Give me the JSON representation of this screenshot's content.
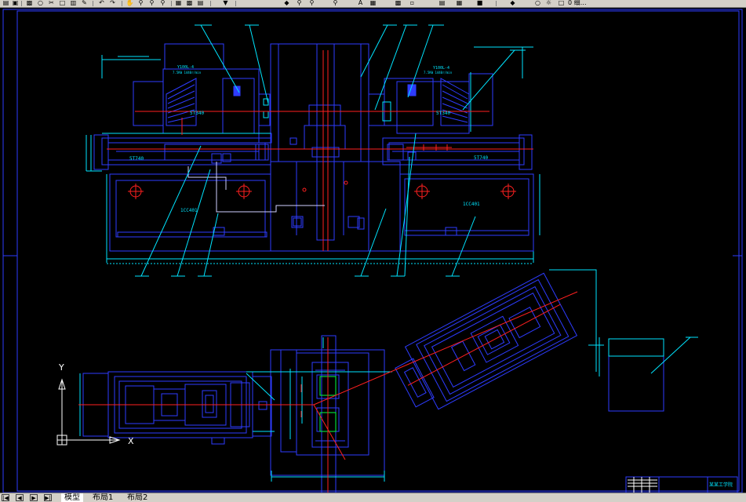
{
  "toolbar": {
    "icons": [
      "open-icon",
      "save-icon",
      "print-icon",
      "preview-icon",
      "cut-icon",
      "copy-icon",
      "paste-icon",
      "match-properties-icon",
      "undo-icon",
      "redo-icon",
      "pan-icon",
      "zoom-realtime-icon",
      "zoom-window-icon",
      "zoom-previous-icon",
      "properties-icon",
      "designcenter-icon",
      "tool-palettes-icon",
      "calculator-icon",
      "help-icon"
    ],
    "letter_a": "A",
    "trailing_text": "0 细…"
  },
  "drawing": {
    "elevation_labels": {
      "left_unit": "1CC401",
      "right_unit": "1CC401",
      "left_head": "5T340",
      "right_head": "5T340",
      "left_slide": "5T740",
      "right_slide": "5T740"
    },
    "motor_labels": {
      "left": "Y100L-4",
      "left_sub": "7.5KW 1440r/min",
      "right": "Y100L-4",
      "right_sub": "7.5KW 1440r/min"
    },
    "ucs": {
      "y_label": "Y",
      "x_label": "X"
    },
    "title_block_text": "某某工学院"
  },
  "tabs": {
    "nav": [
      "|◀",
      "◀",
      "▶",
      "▶|"
    ],
    "items": [
      {
        "label": "模型",
        "active": true
      },
      {
        "label": "布局1",
        "active": false
      },
      {
        "label": "布局2",
        "active": false
      }
    ]
  },
  "colors": {
    "background": "#000000",
    "blue": "#2e3cff",
    "cyan": "#00e5ff",
    "red": "#ff2020",
    "white": "#ffffff",
    "green": "#00ff40",
    "chrome": "#d4d0c8"
  }
}
